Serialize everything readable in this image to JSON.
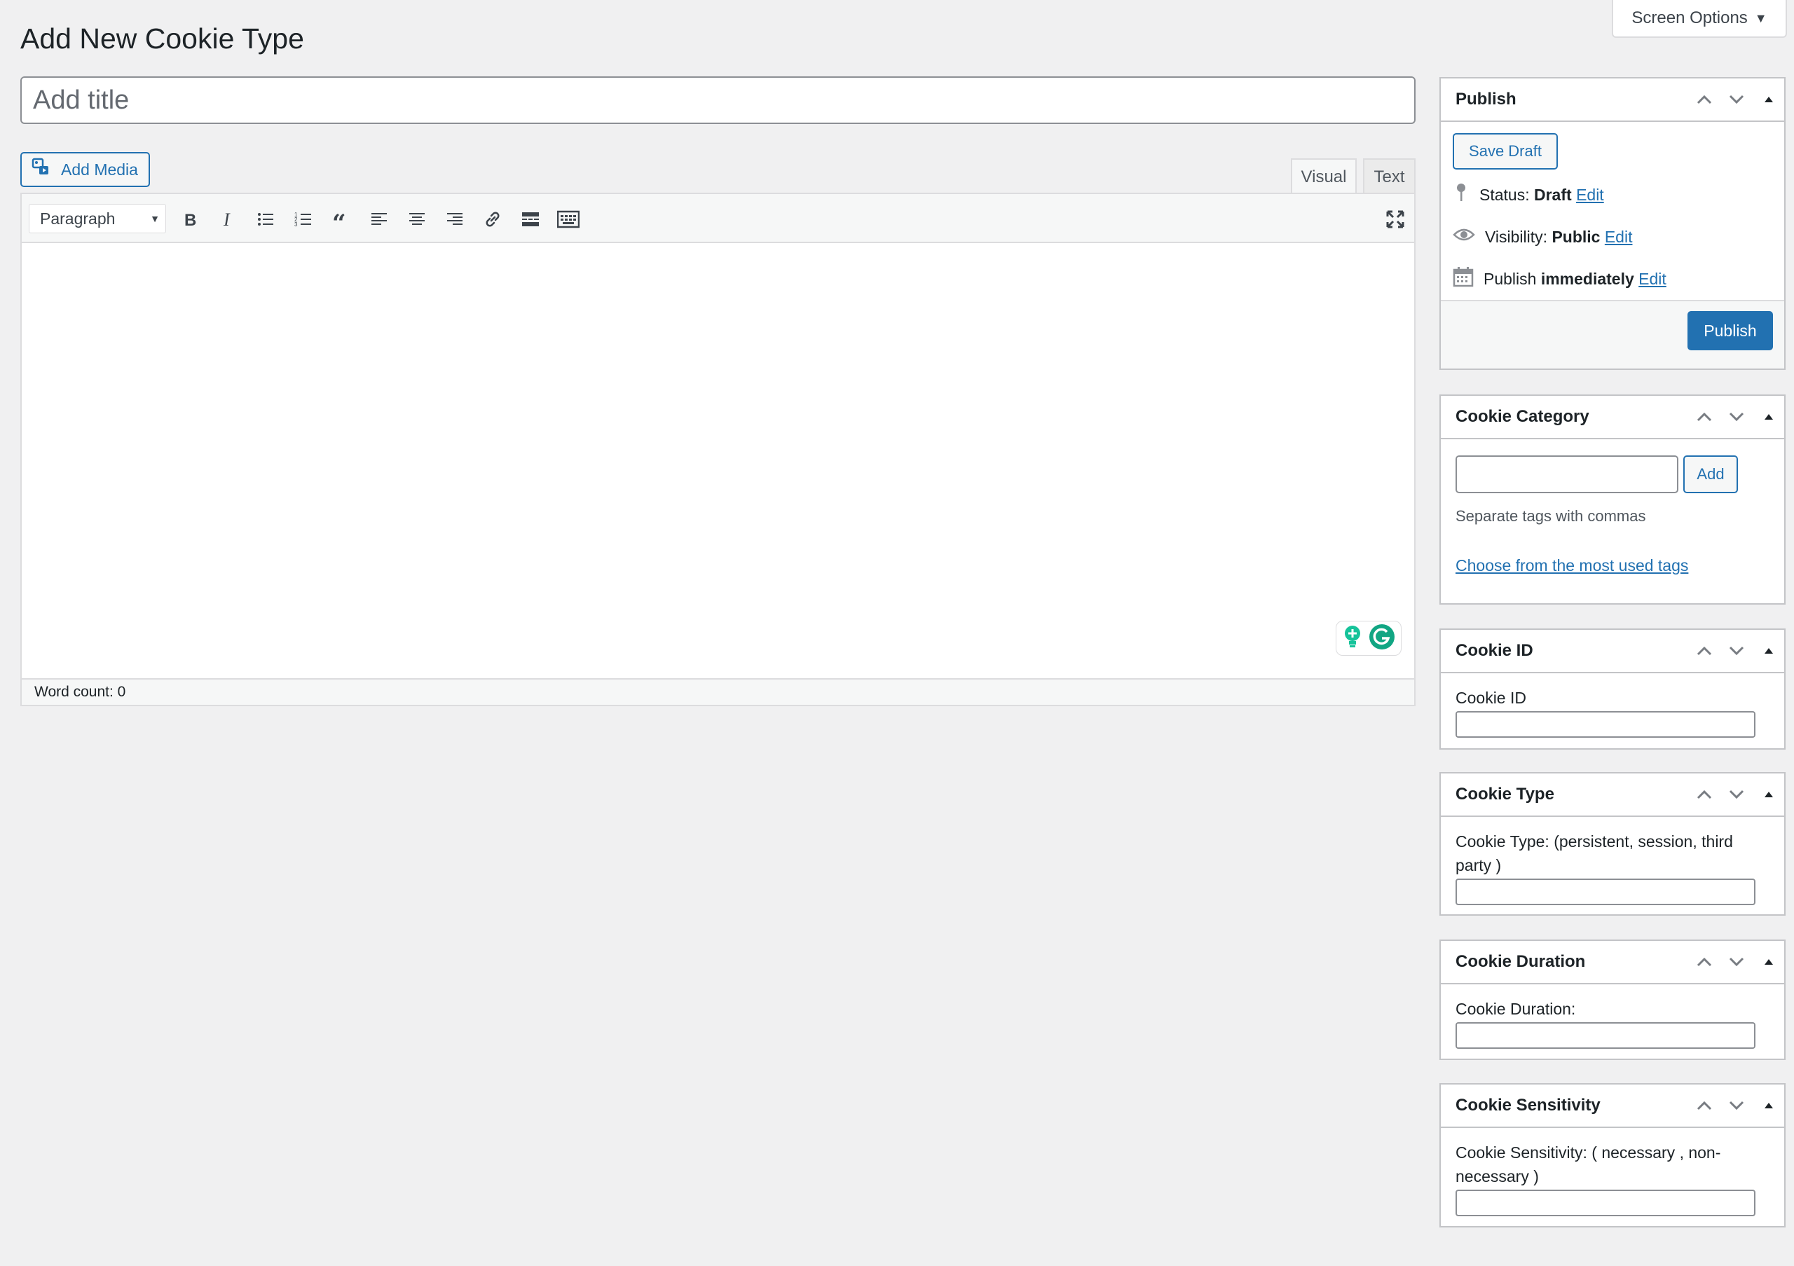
{
  "screen_options": {
    "label": "Screen Options",
    "caret": "▼"
  },
  "page": {
    "title": "Add New Cookie Type"
  },
  "title_field": {
    "placeholder": "Add title"
  },
  "editor": {
    "add_media_label": "Add Media",
    "tab_visual": "Visual",
    "tab_text": "Text",
    "format_value": "Paragraph",
    "word_count": "Word count: 0",
    "toolbar_icons": [
      "bold-icon",
      "italic-icon",
      "bulleted-list-icon",
      "numbered-list-icon",
      "blockquote-icon",
      "align-left-icon",
      "align-center-icon",
      "align-right-icon",
      "link-icon",
      "read-more-icon",
      "toolbar-toggle-icon",
      "fullscreen-icon"
    ]
  },
  "publish": {
    "title": "Publish",
    "save_draft": "Save Draft",
    "status_label": "Status:",
    "status_value": "Draft",
    "visibility_label": "Visibility:",
    "visibility_value": "Public",
    "publish_label": "Publish",
    "publish_value": "immediately",
    "edit_link": "Edit",
    "publish_button": "Publish"
  },
  "cookie_category": {
    "title": "Cookie Category",
    "add_button": "Add",
    "help": "Separate tags with commas",
    "choose_link": "Choose from the most used tags"
  },
  "cookie_id": {
    "title": "Cookie ID",
    "label": "Cookie ID"
  },
  "cookie_type": {
    "title": "Cookie Type",
    "label": "Cookie Type: (persistent, session, third party )"
  },
  "cookie_duration": {
    "title": "Cookie Duration",
    "label": "Cookie Duration:"
  },
  "cookie_sensitivity": {
    "title": "Cookie Sensitivity",
    "label": "Cookie Sensitivity: ( necessary , non-necessary )"
  },
  "colors": {
    "accent": "#2271b1",
    "background": "#f0f0f1",
    "grammarly": "#15c39a"
  }
}
